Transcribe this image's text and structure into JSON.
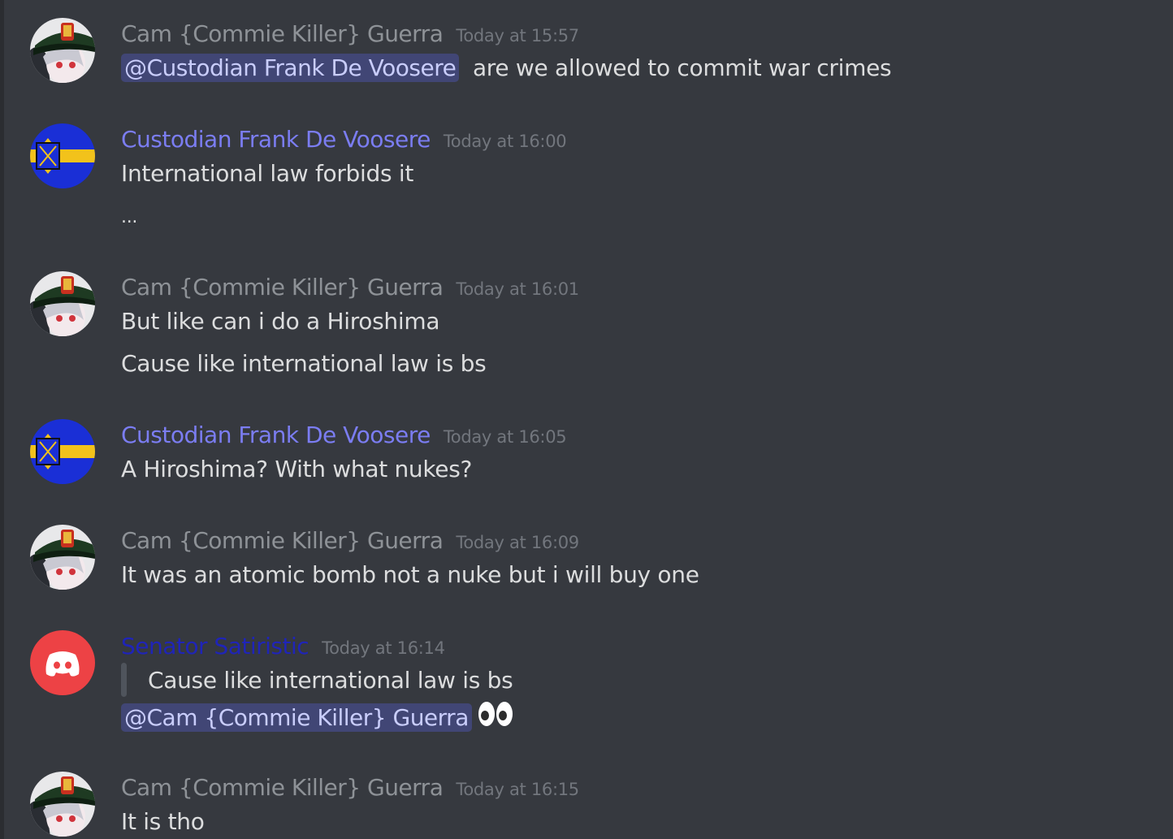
{
  "colors": {
    "background": "#36393f",
    "author_gray": "#8e9297",
    "author_blue": "#7b7df2",
    "author_navy": "#1f24b8",
    "timestamp": "#72767d",
    "mention_bg": "#414675",
    "mention_text": "#c9cdfb"
  },
  "messages": [
    {
      "author": "Cam {Commie Killer} Guerra",
      "author_color": "#8e9297",
      "avatar": "officer-avatar",
      "timestamp": "Today at 15:57",
      "lines": [
        {
          "mention": "@Custodian Frank De Voosere",
          "text": "are we allowed to commit war crimes"
        }
      ]
    },
    {
      "author": "Custodian Frank De Voosere",
      "author_color": "#7b7df2",
      "avatar": "flag-avatar",
      "timestamp": "Today at 16:00",
      "lines": [
        {
          "text": "International law forbids it"
        },
        {
          "text": "..."
        }
      ]
    },
    {
      "author": "Cam {Commie Killer} Guerra",
      "author_color": "#8e9297",
      "avatar": "officer-avatar",
      "timestamp": "Today at 16:01",
      "lines": [
        {
          "text": "But like can i do a Hiroshima"
        },
        {
          "text": "Cause like international law is bs"
        }
      ]
    },
    {
      "author": "Custodian Frank De Voosere",
      "author_color": "#7b7df2",
      "avatar": "flag-avatar",
      "timestamp": "Today at 16:05",
      "lines": [
        {
          "text": "A Hiroshima? With what nukes?"
        }
      ]
    },
    {
      "author": "Cam {Commie Killer} Guerra",
      "author_color": "#8e9297",
      "avatar": "officer-avatar",
      "timestamp": "Today at 16:09",
      "lines": [
        {
          "text": "It was an atomic bomb not a nuke but i will buy one"
        }
      ]
    },
    {
      "author": "Senator Satiristic",
      "author_color": "#1f24b8",
      "avatar": "discord-default-avatar",
      "timestamp": "Today at 16:14",
      "lines": [
        {
          "quote": "Cause like international law is bs"
        },
        {
          "mention": "@Cam {Commie Killer} Guerra",
          "emoji": "eyes-emoji"
        }
      ]
    },
    {
      "author": "Cam {Commie Killer} Guerra",
      "author_color": "#8e9297",
      "avatar": "officer-avatar",
      "timestamp": "Today at 16:15",
      "lines": [
        {
          "text": "It is tho"
        }
      ]
    }
  ]
}
